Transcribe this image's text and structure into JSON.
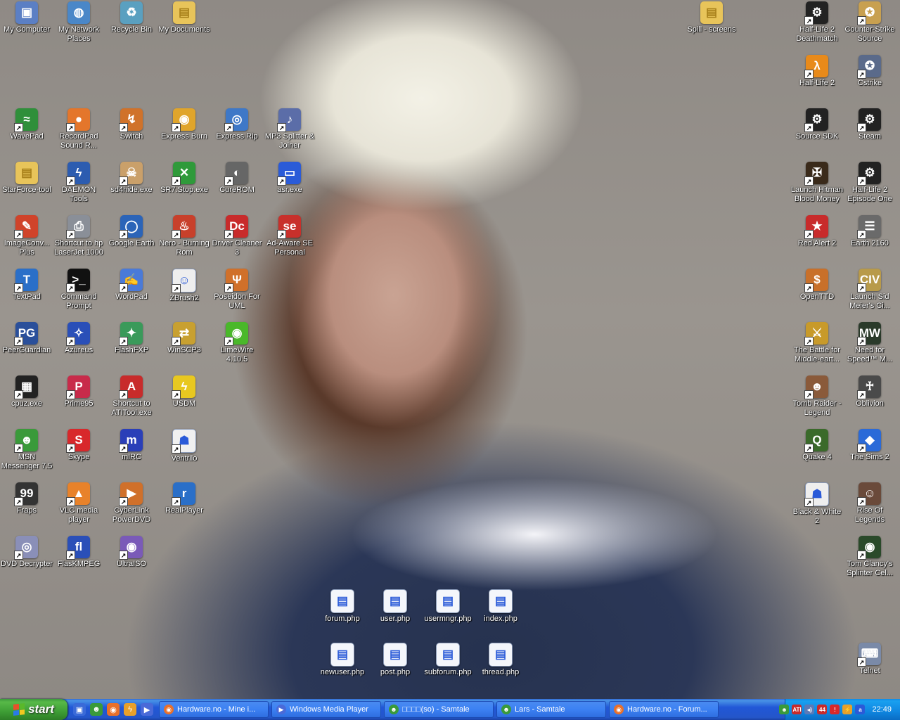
{
  "desktop_icons": [
    {
      "label": "My Computer",
      "glyph": "computer-icon",
      "symbol": "▣",
      "color": "#5b7fc4",
      "shortcut": false
    },
    {
      "label": "My Network Places",
      "glyph": "network-icon",
      "symbol": "◍",
      "color": "#4a87c8",
      "shortcut": false
    },
    {
      "label": "Recycle Bin",
      "glyph": "recycle-bin-icon",
      "symbol": "♻",
      "color": "#5aa0c0",
      "shortcut": false
    },
    {
      "label": "My Documents",
      "glyph": "folder-icon",
      "symbol": "▤",
      "color": "#e8c45a",
      "shortcut": false
    },
    {
      "label": "WavePad",
      "glyph": "wavepad-icon",
      "symbol": "≈",
      "color": "#2f8f3a",
      "shortcut": true
    },
    {
      "label": "RecordPad Sound R...",
      "glyph": "recordpad-icon",
      "symbol": "●",
      "color": "#e4762b",
      "shortcut": true
    },
    {
      "label": "Switch",
      "glyph": "switch-icon",
      "symbol": "↯",
      "color": "#d0722a",
      "shortcut": true
    },
    {
      "label": "Express Burn",
      "glyph": "express-burn-icon",
      "symbol": "◉",
      "color": "#e0a52b",
      "shortcut": true
    },
    {
      "label": "Express Rip",
      "glyph": "express-rip-icon",
      "symbol": "◎",
      "color": "#3e78c7",
      "shortcut": true
    },
    {
      "label": "MP3 Splitter & Joiner",
      "glyph": "mp3-splitter-icon",
      "symbol": "♪",
      "color": "#5b6da8",
      "shortcut": true
    },
    {
      "label": "StarForce-tool",
      "glyph": "folder-icon",
      "symbol": "▤",
      "color": "#e8c45a",
      "shortcut": false
    },
    {
      "label": "DAEMON Tools",
      "glyph": "daemon-tools-icon",
      "symbol": "ϟ",
      "color": "#2c5cb0",
      "shortcut": true
    },
    {
      "label": "sd4hide.exe",
      "glyph": "skull-icon",
      "symbol": "☠",
      "color": "#caa06a",
      "shortcut": true
    },
    {
      "label": "SR7.Stop.exe",
      "glyph": "stop-icon",
      "symbol": "✕",
      "color": "#2f9a3a",
      "shortcut": true
    },
    {
      "label": "CureROM",
      "glyph": "cure-rom-icon",
      "symbol": "◐",
      "color": "#666666",
      "shortcut": true
    },
    {
      "label": "asr.exe",
      "glyph": "window-icon",
      "symbol": "▭",
      "color": "#2a5bd8",
      "shortcut": true
    },
    {
      "label": "ImageConv... Plus",
      "glyph": "imageconv-icon",
      "symbol": "✎",
      "color": "#d0432a",
      "shortcut": true
    },
    {
      "label": "Shortcut to hp LaserJet 1000",
      "glyph": "printer-icon",
      "symbol": "⎙",
      "color": "#8a8f98",
      "shortcut": true
    },
    {
      "label": "Google Earth",
      "glyph": "google-earth-icon",
      "symbol": "◯",
      "color": "#2b64b8",
      "shortcut": true
    },
    {
      "label": "Nero - Burning Rom",
      "glyph": "nero-icon",
      "symbol": "♨",
      "color": "#c8402b",
      "shortcut": true
    },
    {
      "label": "Driver Cleaner 3",
      "glyph": "driver-cleaner-icon",
      "symbol": "Dc",
      "color": "#c82b2b",
      "shortcut": true
    },
    {
      "label": "Ad-Aware SE Personal",
      "glyph": "ad-aware-icon",
      "symbol": "se",
      "color": "#c8302b",
      "shortcut": true
    },
    {
      "label": "TextPad",
      "glyph": "textpad-icon",
      "symbol": "T",
      "color": "#2a6fc8",
      "shortcut": true
    },
    {
      "label": "Command Prompt",
      "glyph": "command-prompt-icon",
      "symbol": ">_",
      "color": "#111111",
      "shortcut": true
    },
    {
      "label": "WordPad",
      "glyph": "wordpad-icon",
      "symbol": "✍",
      "color": "#4a7ad8",
      "shortcut": true
    },
    {
      "label": "ZBrush2",
      "glyph": "zbrush-icon",
      "symbol": "☺",
      "color": "#eeeeee",
      "shortcut": true
    },
    {
      "label": "Poseidon For UML",
      "glyph": "poseidon-icon",
      "symbol": "Ψ",
      "color": "#d0702a",
      "shortcut": true
    },
    {
      "label": "PeerGuardian",
      "glyph": "peerguardian-icon",
      "symbol": "PG",
      "color": "#2a4f9a",
      "shortcut": true
    },
    {
      "label": "Azureus",
      "glyph": "azureus-icon",
      "symbol": "✧",
      "color": "#2a4fb8",
      "shortcut": true
    },
    {
      "label": "FlashFXP",
      "glyph": "flashfxp-icon",
      "symbol": "✦",
      "color": "#3a9a5a",
      "shortcut": true
    },
    {
      "label": "WinSCP3",
      "glyph": "winscp-icon",
      "symbol": "⇄",
      "color": "#c8a030",
      "shortcut": true
    },
    {
      "label": "LimeWire 4.10.5",
      "glyph": "limewire-icon",
      "symbol": "◉",
      "color": "#4ab82a",
      "shortcut": true
    },
    {
      "label": "cpuz.exe",
      "glyph": "cpu-icon",
      "symbol": "▦",
      "color": "#222222",
      "shortcut": true
    },
    {
      "label": "Prime95",
      "glyph": "prime95-icon",
      "symbol": "P",
      "color": "#c82b4a",
      "shortcut": true
    },
    {
      "label": "Shortcut to ATITool.exe",
      "glyph": "atitool-icon",
      "symbol": "A",
      "color": "#c82b2b",
      "shortcut": true
    },
    {
      "label": "USDM",
      "glyph": "usdm-icon",
      "symbol": "ϟ",
      "color": "#e8c820",
      "shortcut": true
    },
    {
      "label": "MSN Messenger 7.5",
      "glyph": "msn-icon",
      "symbol": "☻",
      "color": "#3a9a3a",
      "shortcut": true
    },
    {
      "label": "Skype",
      "glyph": "skype-icon",
      "symbol": "S",
      "color": "#d8282b",
      "shortcut": true
    },
    {
      "label": "mIRC",
      "glyph": "mirc-icon",
      "symbol": "m",
      "color": "#2a3fb8",
      "shortcut": true
    },
    {
      "label": "Ventrilo",
      "glyph": "ventrilo-icon",
      "symbol": "☗",
      "color": "#f0f0f0",
      "shortcut": true
    },
    {
      "label": "Fraps",
      "glyph": "fraps-icon",
      "symbol": "99",
      "color": "#333333",
      "shortcut": true
    },
    {
      "label": "VLC media player",
      "glyph": "vlc-icon",
      "symbol": "▲",
      "color": "#e8822a",
      "shortcut": true
    },
    {
      "label": "CyberLink PowerDVD",
      "glyph": "powerdvd-icon",
      "symbol": "▶",
      "color": "#d0702a",
      "shortcut": true
    },
    {
      "label": "RealPlayer",
      "glyph": "realplayer-icon",
      "symbol": "r",
      "color": "#2a6fc8",
      "shortcut": true
    },
    {
      "label": "DVD Decrypter",
      "glyph": "dvd-icon",
      "symbol": "◎",
      "color": "#8a8fb8",
      "shortcut": true
    },
    {
      "label": "FlasKMPEG",
      "glyph": "flaskmpeg-icon",
      "symbol": "fl",
      "color": "#2a4fb8",
      "shortcut": true
    },
    {
      "label": "UltraISO",
      "glyph": "ultraiso-icon",
      "symbol": "◉",
      "color": "#7a5ab8",
      "shortcut": true
    },
    {
      "label": "Spill - screens",
      "glyph": "folder-icon",
      "symbol": "▤",
      "color": "#e8c45a",
      "shortcut": false
    },
    {
      "label": "Half-Life 2 Deathmatch",
      "glyph": "steam-icon",
      "symbol": "⚙",
      "color": "#222222",
      "shortcut": true
    },
    {
      "label": "Counter-Strike Source",
      "glyph": "counter-strike-icon",
      "symbol": "✪",
      "color": "#c8a050",
      "shortcut": true
    },
    {
      "label": "Half-Life 2",
      "glyph": "half-life-icon",
      "symbol": "λ",
      "color": "#e88a1a",
      "shortcut": true
    },
    {
      "label": "Cstrike",
      "glyph": "cstrike-icon",
      "symbol": "✪",
      "color": "#5a6a8a",
      "shortcut": true
    },
    {
      "label": "Source SDK",
      "glyph": "steam-icon",
      "symbol": "⚙",
      "color": "#222222",
      "shortcut": true
    },
    {
      "label": "Steam",
      "glyph": "steam-icon",
      "symbol": "⚙",
      "color": "#222222",
      "shortcut": true
    },
    {
      "label": "Launch Hitman Blood Money",
      "glyph": "hitman-icon",
      "symbol": "✠",
      "color": "#3a2a1a",
      "shortcut": true
    },
    {
      "label": "Half-Life 2 Episode One",
      "glyph": "steam-icon",
      "symbol": "⚙",
      "color": "#222222",
      "shortcut": true
    },
    {
      "label": "Red Alert 2",
      "glyph": "red-alert-icon",
      "symbol": "★",
      "color": "#c82b2b",
      "shortcut": true
    },
    {
      "label": "Earth 2160",
      "glyph": "earth-2160-icon",
      "symbol": "☰",
      "color": "#6a6a6a",
      "shortcut": true
    },
    {
      "label": "OpenTTD",
      "glyph": "openttd-icon",
      "symbol": "$",
      "color": "#c8702a",
      "shortcut": true
    },
    {
      "label": "Launch Sid Meier's Ci...",
      "glyph": "civilization-icon",
      "symbol": "CIV",
      "color": "#b89a4a",
      "shortcut": true
    },
    {
      "label": "The Battle for Middle-eart...",
      "glyph": "battle-middle-earth-icon",
      "symbol": "⚔",
      "color": "#c89a2a",
      "shortcut": true
    },
    {
      "label": "Need for Speed™ M...",
      "glyph": "nfs-icon",
      "symbol": "MW",
      "color": "#2a3a2a",
      "shortcut": true
    },
    {
      "label": "Tomb Raider - Legend",
      "glyph": "tomb-raider-icon",
      "symbol": "☻",
      "color": "#8a5a3a",
      "shortcut": true
    },
    {
      "label": "Oblivion",
      "glyph": "oblivion-icon",
      "symbol": "♰",
      "color": "#4a4a4a",
      "shortcut": true
    },
    {
      "label": "Quake 4",
      "glyph": "quake-icon",
      "symbol": "Q",
      "color": "#3a6a2a",
      "shortcut": true
    },
    {
      "label": "The Sims 2",
      "glyph": "sims-icon",
      "symbol": "◆",
      "color": "#2a6ad8",
      "shortcut": true
    },
    {
      "label": "Black & White 2",
      "glyph": "black-white-icon",
      "symbol": "☗",
      "color": "#eeeeee",
      "shortcut": true
    },
    {
      "label": "Rise Of Legends",
      "glyph": "rise-of-legends-icon",
      "symbol": "☺",
      "color": "#6a4a3a",
      "shortcut": true
    },
    {
      "label": "Tom Clancy's Splinter Cel...",
      "glyph": "splinter-cell-icon",
      "symbol": "◉",
      "color": "#2a4a2a",
      "shortcut": true
    },
    {
      "label": "forum.php",
      "glyph": "php-file-icon",
      "symbol": "▤",
      "color": "#f4f6fb",
      "shortcut": false
    },
    {
      "label": "user.php",
      "glyph": "php-file-icon",
      "symbol": "▤",
      "color": "#f4f6fb",
      "shortcut": false
    },
    {
      "label": "usermngr.php",
      "glyph": "php-file-icon",
      "symbol": "▤",
      "color": "#f4f6fb",
      "shortcut": false
    },
    {
      "label": "index.php",
      "glyph": "php-file-icon",
      "symbol": "▤",
      "color": "#f4f6fb",
      "shortcut": false
    },
    {
      "label": "newuser.php",
      "glyph": "php-file-icon",
      "symbol": "▤",
      "color": "#f4f6fb",
      "shortcut": false
    },
    {
      "label": "post.php",
      "glyph": "php-file-icon",
      "symbol": "▤",
      "color": "#f4f6fb",
      "shortcut": false
    },
    {
      "label": "subforum.php",
      "glyph": "php-file-icon",
      "symbol": "▤",
      "color": "#f4f6fb",
      "shortcut": false
    },
    {
      "label": "thread.php",
      "glyph": "php-file-icon",
      "symbol": "▤",
      "color": "#f4f6fb",
      "shortcut": false
    },
    {
      "label": "Telnet",
      "glyph": "telnet-icon",
      "symbol": "⌨",
      "color": "#7a8aa8",
      "shortcut": true
    }
  ],
  "taskbar": {
    "start_label": "start",
    "quick_launch": [
      {
        "name": "show-desktop-icon",
        "symbol": "▣",
        "color": "#3a6ad8"
      },
      {
        "name": "messenger-icon",
        "symbol": "☻",
        "color": "#3a9a3a"
      },
      {
        "name": "firefox-icon",
        "symbol": "◉",
        "color": "#e8702a"
      },
      {
        "name": "winamp-icon",
        "symbol": "ϟ",
        "color": "#e8a02a"
      },
      {
        "name": "media-player-icon",
        "symbol": "▶",
        "color": "#4a6ad8"
      }
    ],
    "tasks": [
      {
        "label": "Hardware.no - Mine i...",
        "icon": "firefox-icon",
        "symbol": "◉",
        "color": "#e8702a"
      },
      {
        "label": "Windows Media Player",
        "icon": "media-player-icon",
        "symbol": "▶",
        "color": "#4a6ad8"
      },
      {
        "label": "□□□□(so) - Samtale",
        "icon": "messenger-icon",
        "symbol": "☻",
        "color": "#3a9a3a"
      },
      {
        "label": "Lars - Samtale",
        "icon": "messenger-icon",
        "symbol": "☻",
        "color": "#3a9a3a"
      },
      {
        "label": "Hardware.no - Forum...",
        "icon": "firefox-icon",
        "symbol": "◉",
        "color": "#e8702a"
      }
    ],
    "tray": [
      {
        "name": "network-tray-icon",
        "symbol": "☻",
        "color": "#3a9a3a"
      },
      {
        "name": "ati-tray-icon",
        "symbol": "ATI",
        "color": "#c82b2b"
      },
      {
        "name": "volume-tray-icon",
        "symbol": "◂)",
        "color": "#5a7ab8"
      },
      {
        "name": "cpu-temp-tray-icon",
        "symbol": "44",
        "color": "#c82b2b"
      },
      {
        "name": "security-tray-icon",
        "symbol": "!",
        "color": "#d8282b"
      },
      {
        "name": "update-tray-icon",
        "symbol": "⚡",
        "color": "#e8a02a"
      },
      {
        "name": "ad-aware-tray-icon",
        "symbol": "a",
        "color": "#2a5ad8"
      }
    ],
    "clock": "22:49"
  }
}
